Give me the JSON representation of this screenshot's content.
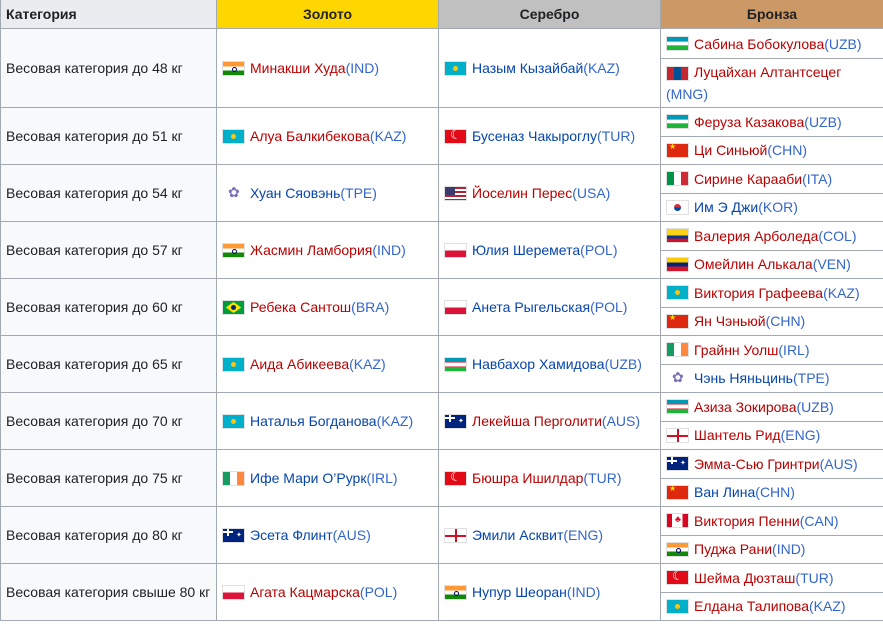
{
  "headers": {
    "category": "Категория",
    "gold": "Золото",
    "silver": "Серебро",
    "bronze": "Бронза"
  },
  "rows": [
    {
      "category": "Весовая категория до 48 кг",
      "gold": {
        "flag": "IND",
        "name": "Минакши Худа",
        "code": "(IND)",
        "link": "red"
      },
      "silver": {
        "flag": "KAZ",
        "name": "Назым Кызайбай",
        "code": "(KAZ)",
        "link": "blue"
      },
      "bronze": [
        {
          "flag": "UZB",
          "name": "Сабина Бобокулова",
          "code": "(UZB)",
          "link": "red"
        },
        {
          "flag": "MNG",
          "name": "Луцайхан Алтантсецег",
          "code": "(MNG)",
          "link": "red",
          "wrap": true
        }
      ]
    },
    {
      "category": "Весовая категория до 51 кг",
      "gold": {
        "flag": "KAZ",
        "name": "Алуа Балкибекова",
        "code": "(KAZ)",
        "link": "red"
      },
      "silver": {
        "flag": "TUR",
        "name": "Бусеназ Чакыроглу",
        "code": "(TUR)",
        "link": "blue"
      },
      "bronze": [
        {
          "flag": "UZB",
          "name": "Феруза Казакова",
          "code": "(UZB)",
          "link": "red"
        },
        {
          "flag": "CHN",
          "name": "Ци Синьюй",
          "code": "(CHN)",
          "link": "red"
        }
      ]
    },
    {
      "category": "Весовая категория до 54 кг",
      "gold": {
        "flag": "TPE",
        "name": "Хуан Сяовэнь",
        "code": "(TPE)",
        "link": "blue"
      },
      "silver": {
        "flag": "USA",
        "name": "Йоселин Перес",
        "code": "(USA)",
        "link": "red"
      },
      "bronze": [
        {
          "flag": "ITA",
          "name": "Сирине Карааби",
          "code": "(ITA)",
          "link": "red"
        },
        {
          "flag": "KOR",
          "name": "Им Э Джи",
          "code": "(KOR)",
          "link": "blue"
        }
      ]
    },
    {
      "category": "Весовая категория до 57 кг",
      "gold": {
        "flag": "IND",
        "name": "Жасмин Ламбория",
        "code": "(IND)",
        "link": "red"
      },
      "silver": {
        "flag": "POL",
        "name": "Юлия Шеремета",
        "code": "(POL)",
        "link": "blue"
      },
      "bronze": [
        {
          "flag": "COL",
          "name": "Валерия Арболеда",
          "code": "(COL)",
          "link": "red"
        },
        {
          "flag": "VEN",
          "name": "Омейлин Алькала",
          "code": "(VEN)",
          "link": "red"
        }
      ]
    },
    {
      "category": "Весовая категория до 60 кг",
      "gold": {
        "flag": "BRA",
        "name": "Ребека Сантош",
        "code": "(BRA)",
        "link": "red"
      },
      "silver": {
        "flag": "POL",
        "name": "Анета Рыгельская",
        "code": "(POL)",
        "link": "blue"
      },
      "bronze": [
        {
          "flag": "KAZ",
          "name": "Виктория Графеева",
          "code": "(KAZ)",
          "link": "red"
        },
        {
          "flag": "CHN",
          "name": "Ян Чэньюй",
          "code": "(CHN)",
          "link": "red"
        }
      ]
    },
    {
      "category": "Весовая категория до 65 кг",
      "gold": {
        "flag": "KAZ",
        "name": "Аида Абикеева",
        "code": "(KAZ)",
        "link": "red"
      },
      "silver": {
        "flag": "UZB",
        "name": "Навбахор Хамидова",
        "code": "(UZB)",
        "link": "blue"
      },
      "bronze": [
        {
          "flag": "IRL",
          "name": "Грайнн Уолш",
          "code": "(IRL)",
          "link": "red"
        },
        {
          "flag": "TPE",
          "name": "Чэнь Няньцинь",
          "code": "(TPE)",
          "link": "blue"
        }
      ]
    },
    {
      "category": "Весовая категория до 70 кг",
      "gold": {
        "flag": "KAZ",
        "name": "Наталья Богданова",
        "code": "(KAZ)",
        "link": "blue"
      },
      "silver": {
        "flag": "AUS",
        "name": "Лекейша Перголити",
        "code": "(AUS)",
        "link": "red"
      },
      "bronze": [
        {
          "flag": "UZB",
          "name": "Азиза Зокирова",
          "code": "(UZB)",
          "link": "red"
        },
        {
          "flag": "ENG",
          "name": "Шантель Рид",
          "code": "(ENG)",
          "link": "red"
        }
      ]
    },
    {
      "category": "Весовая категория до 75 кг",
      "gold": {
        "flag": "IRL",
        "name": "Ифе Мари О’Рурк",
        "code": "(IRL)",
        "link": "blue"
      },
      "silver": {
        "flag": "TUR",
        "name": "Бюшра Ишилдар",
        "code": "(TUR)",
        "link": "red"
      },
      "bronze": [
        {
          "flag": "AUS",
          "name": "Эмма-Сью Гринтри",
          "code": "(AUS)",
          "link": "red"
        },
        {
          "flag": "CHN",
          "name": "Ван Лина",
          "code": "(CHN)",
          "link": "blue"
        }
      ]
    },
    {
      "category": "Весовая категория до 80 кг",
      "gold": {
        "flag": "AUS",
        "name": "Эсета Флинт",
        "code": "(AUS)",
        "link": "blue"
      },
      "silver": {
        "flag": "ENG",
        "name": "Эмили Асквит",
        "code": "(ENG)",
        "link": "blue"
      },
      "bronze": [
        {
          "flag": "CAN",
          "name": "Виктория Пенни",
          "code": "(CAN)",
          "link": "red"
        },
        {
          "flag": "IND",
          "name": "Пуджа Рани",
          "code": "(IND)",
          "link": "red"
        }
      ]
    },
    {
      "category": "Весовая категория свыше 80 кг",
      "gold": {
        "flag": "POL",
        "name": "Агата Кацмарска",
        "code": "(POL)",
        "link": "red"
      },
      "silver": {
        "flag": "IND",
        "name": "Нупур Шеоран",
        "code": "(IND)",
        "link": "blue"
      },
      "bronze": [
        {
          "flag": "TUR",
          "name": "Шейма Дюзташ",
          "code": "(TUR)",
          "link": "red"
        },
        {
          "flag": "KAZ",
          "name": "Елдана Талипова",
          "code": "(KAZ)",
          "link": "red"
        }
      ]
    }
  ],
  "colors": {
    "red_link": "#ba0000",
    "blue_link": "#0645ad",
    "gold": "#ffd700",
    "silver": "#c0c0c0",
    "bronze": "#cc9966"
  }
}
